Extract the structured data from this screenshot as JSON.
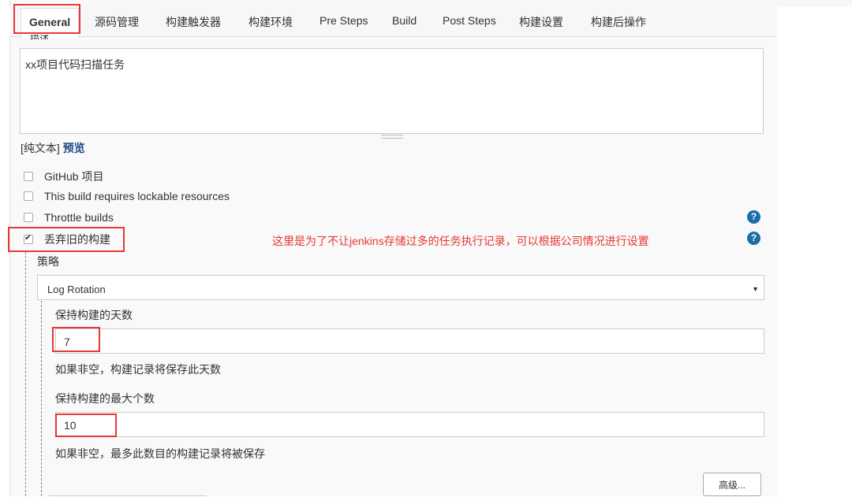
{
  "tabs": [
    {
      "label": "General",
      "active": true
    },
    {
      "label": "源码管理"
    },
    {
      "label": "构建触发器"
    },
    {
      "label": "构建环境"
    },
    {
      "label": "Pre Steps"
    },
    {
      "label": "Build"
    },
    {
      "label": "Post Steps"
    },
    {
      "label": "构建设置"
    },
    {
      "label": "构建后操作"
    }
  ],
  "description": {
    "label": "描述",
    "value": "xx项目代码扫描任务",
    "format_label": "[纯文本]",
    "preview_link": "预览"
  },
  "options": [
    {
      "label": "GitHub 项目",
      "checked": false
    },
    {
      "label": "This build requires lockable resources",
      "checked": false
    },
    {
      "label": "Throttle builds",
      "checked": false
    },
    {
      "label": "丢弃旧的构建",
      "checked": true
    }
  ],
  "help_icon": "?",
  "annotation": "这里是为了不让jenkins存储过多的任务执行记录，可以根据公司情况进行设置",
  "strategy": {
    "label": "策略",
    "selected": "Log Rotation"
  },
  "days_to_keep": {
    "label": "保持构建的天数",
    "value": "7",
    "hint": "如果非空，构建记录将保存此天数"
  },
  "max_builds": {
    "label": "保持构建的最大个数",
    "value": "10",
    "hint": "如果非空，最多此数目的构建记录将被保存"
  },
  "advanced_button": "高级...",
  "colors": {
    "highlight": "#e53935",
    "help": "#1b6ca8",
    "link": "#204a87"
  }
}
